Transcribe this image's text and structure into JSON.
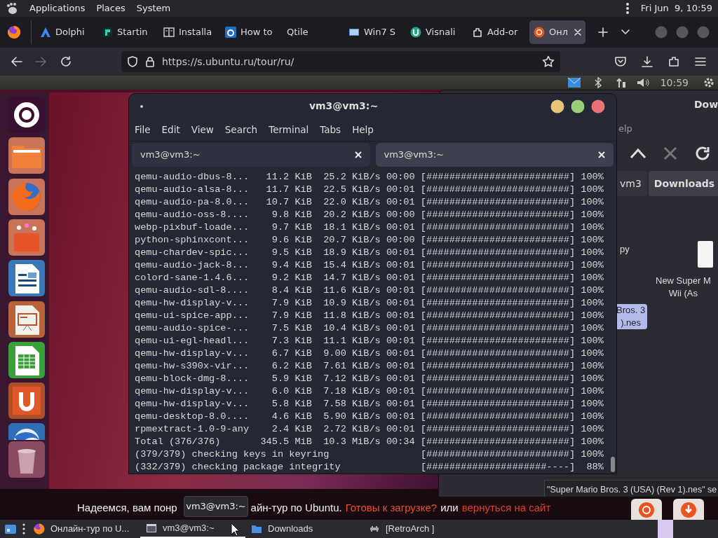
{
  "top_panel": {
    "menus": [
      "Applications",
      "Places",
      "System"
    ],
    "clock": "Fri Jun  9, 10:59"
  },
  "browser": {
    "tabs": [
      {
        "label": "Dolphi",
        "selected": false
      },
      {
        "label": "Startin",
        "selected": false
      },
      {
        "label": "Installa",
        "selected": false
      },
      {
        "label": "How to",
        "selected": false
      },
      {
        "label": "Qtile",
        "selected": false
      },
      {
        "label": "Win7 S",
        "selected": false
      },
      {
        "label": "Visnali",
        "selected": false
      },
      {
        "label": "Add-or",
        "selected": false
      },
      {
        "label": "Онл",
        "selected": true
      }
    ],
    "url": "https://s.ubuntu.ru/tour/ru/"
  },
  "tour": {
    "panel_clock": "10:59",
    "file_manager": {
      "title": "Dow",
      "menu": "elp",
      "path": [
        {
          "label": "vm3",
          "selected": false
        },
        {
          "label": "Downloads",
          "selected": true
        }
      ],
      "files": [
        {
          "lines": [
            "py"
          ],
          "selected": false,
          "kind": "partial"
        },
        {
          "lines": [
            "New Super M",
            "Wii (As"
          ],
          "selected": false,
          "kind": "file"
        },
        {
          "lines": [
            "Bros. 3",
            ").nes"
          ],
          "selected": true,
          "kind": "partial"
        }
      ],
      "status": "\"Super Mario Bros. 3 (USA) (Rev 1).nes\" se"
    },
    "terminal": {
      "title": "vm3@vm3:~",
      "menu": [
        "File",
        "Edit",
        "View",
        "Search",
        "Terminal",
        "Tabs",
        "Help"
      ],
      "tabs": [
        {
          "label": "vm3@vm3:~",
          "selected": false
        },
        {
          "label": "vm3@vm3:~",
          "selected": true
        }
      ],
      "lines": [
        {
          "kind": "download",
          "name": "qemu-audio-dbus-8...",
          "size": "11.2 KiB",
          "speed": "25.2 KiB/s",
          "time": "00:00",
          "bar": "[#########################]",
          "percent": "100%"
        },
        {
          "kind": "download",
          "name": "qemu-audio-alsa-8...",
          "size": "11.7 KiB",
          "speed": "22.5 KiB/s",
          "time": "00:01",
          "bar": "[#########################]",
          "percent": "100%"
        },
        {
          "kind": "download",
          "name": "qemu-audio-pa-8.0...",
          "size": "10.7 KiB",
          "speed": "22.0 KiB/s",
          "time": "00:01",
          "bar": "[#########################]",
          "percent": "100%"
        },
        {
          "kind": "download",
          "name": "qemu-audio-oss-8....",
          "size": "9.8 KiB",
          "speed": "20.2 KiB/s",
          "time": "00:00",
          "bar": "[#########################]",
          "percent": "100%"
        },
        {
          "kind": "download",
          "name": "webp-pixbuf-loade...",
          "size": "9.7 KiB",
          "speed": "18.1 KiB/s",
          "time": "00:01",
          "bar": "[#########################]",
          "percent": "100%"
        },
        {
          "kind": "download",
          "name": "python-sphinxcont...",
          "size": "9.6 KiB",
          "speed": "20.7 KiB/s",
          "time": "00:00",
          "bar": "[#########################]",
          "percent": "100%"
        },
        {
          "kind": "download",
          "name": "qemu-chardev-spic...",
          "size": "9.5 KiB",
          "speed": "18.9 KiB/s",
          "time": "00:01",
          "bar": "[#########################]",
          "percent": "100%"
        },
        {
          "kind": "download",
          "name": "qemu-audio-jack-8...",
          "size": "9.4 KiB",
          "speed": "15.4 KiB/s",
          "time": "00:01",
          "bar": "[#########################]",
          "percent": "100%"
        },
        {
          "kind": "download",
          "name": "colord-sane-1.4.6...",
          "size": "9.2 KiB",
          "speed": "14.7 KiB/s",
          "time": "00:01",
          "bar": "[#########################]",
          "percent": "100%"
        },
        {
          "kind": "download",
          "name": "qemu-audio-sdl-8....",
          "size": "8.4 KiB",
          "speed": "11.6 KiB/s",
          "time": "00:01",
          "bar": "[#########################]",
          "percent": "100%"
        },
        {
          "kind": "download",
          "name": "qemu-hw-display-v...",
          "size": "7.9 KiB",
          "speed": "10.9 KiB/s",
          "time": "00:01",
          "bar": "[#########################]",
          "percent": "100%"
        },
        {
          "kind": "download",
          "name": "qemu-ui-spice-app...",
          "size": "7.9 KiB",
          "speed": "11.8 KiB/s",
          "time": "00:01",
          "bar": "[#########################]",
          "percent": "100%"
        },
        {
          "kind": "download",
          "name": "qemu-audio-spice-...",
          "size": "7.5 KiB",
          "speed": "10.4 KiB/s",
          "time": "00:01",
          "bar": "[#########################]",
          "percent": "100%"
        },
        {
          "kind": "download",
          "name": "qemu-ui-egl-headl...",
          "size": "7.3 KiB",
          "speed": "11.1 KiB/s",
          "time": "00:01",
          "bar": "[#########################]",
          "percent": "100%"
        },
        {
          "kind": "download",
          "name": "qemu-hw-display-v...",
          "size": "6.7 KiB",
          "speed": "9.00 KiB/s",
          "time": "00:01",
          "bar": "[#########################]",
          "percent": "100%"
        },
        {
          "kind": "download",
          "name": "qemu-hw-s390x-vir...",
          "size": "6.2 KiB",
          "speed": "7.61 KiB/s",
          "time": "00:01",
          "bar": "[#########################]",
          "percent": "100%"
        },
        {
          "kind": "download",
          "name": "qemu-block-dmg-8....",
          "size": "5.9 KiB",
          "speed": "7.12 KiB/s",
          "time": "00:01",
          "bar": "[#########################]",
          "percent": "100%"
        },
        {
          "kind": "download",
          "name": "qemu-hw-display-v...",
          "size": "6.0 KiB",
          "speed": "7.18 KiB/s",
          "time": "00:01",
          "bar": "[#########################]",
          "percent": "100%"
        },
        {
          "kind": "download",
          "name": "qemu-hw-display-v...",
          "size": "5.8 KiB",
          "speed": "7.58 KiB/s",
          "time": "00:01",
          "bar": "[#########################]",
          "percent": "100%"
        },
        {
          "kind": "download",
          "name": "qemu-desktop-8.0....",
          "size": "4.6 KiB",
          "speed": "5.90 KiB/s",
          "time": "00:01",
          "bar": "[#########################]",
          "percent": "100%"
        },
        {
          "kind": "download",
          "name": "rpmextract-1.0-9-any",
          "size": "2.4 KiB",
          "speed": "2.72 KiB/s",
          "time": "00:01",
          "bar": "[#########################]",
          "percent": "100%"
        },
        {
          "kind": "download",
          "name": "Total (376/376)",
          "size": "345.5 MiB",
          "speed": "10.3 MiB/s",
          "time": "00:34",
          "bar": "[#########################]",
          "percent": "100%"
        },
        {
          "kind": "check",
          "name": "(379/379) checking keys in keyring",
          "bar": "[#########################]",
          "percent": "100%"
        },
        {
          "kind": "check",
          "name": "(332/379) checking package integrity",
          "bar": "[#####################----]",
          "percent": "88%"
        }
      ]
    },
    "footer": [
      {
        "kind": "text",
        "text": "Надеемся, вам понр"
      },
      {
        "kind": "text",
        "text": "айн-тур по Ubuntu."
      },
      {
        "kind": "link",
        "text": "Готовы к загрузке?",
        "color": "#e95420"
      },
      {
        "kind": "text",
        "text": "или"
      },
      {
        "kind": "link",
        "text": "вернуться на сайт",
        "color": "#e0401f"
      }
    ],
    "tooltip": "vm3@vm3:~"
  },
  "taskbar": {
    "items": [
      {
        "label": "Онлайн-тур по U...",
        "selected": false
      },
      {
        "label": "vm3@vm3:~",
        "selected": true
      },
      {
        "label": "Downloads",
        "selected": false
      },
      {
        "label": "[RetroArch ]",
        "selected": false
      }
    ]
  }
}
